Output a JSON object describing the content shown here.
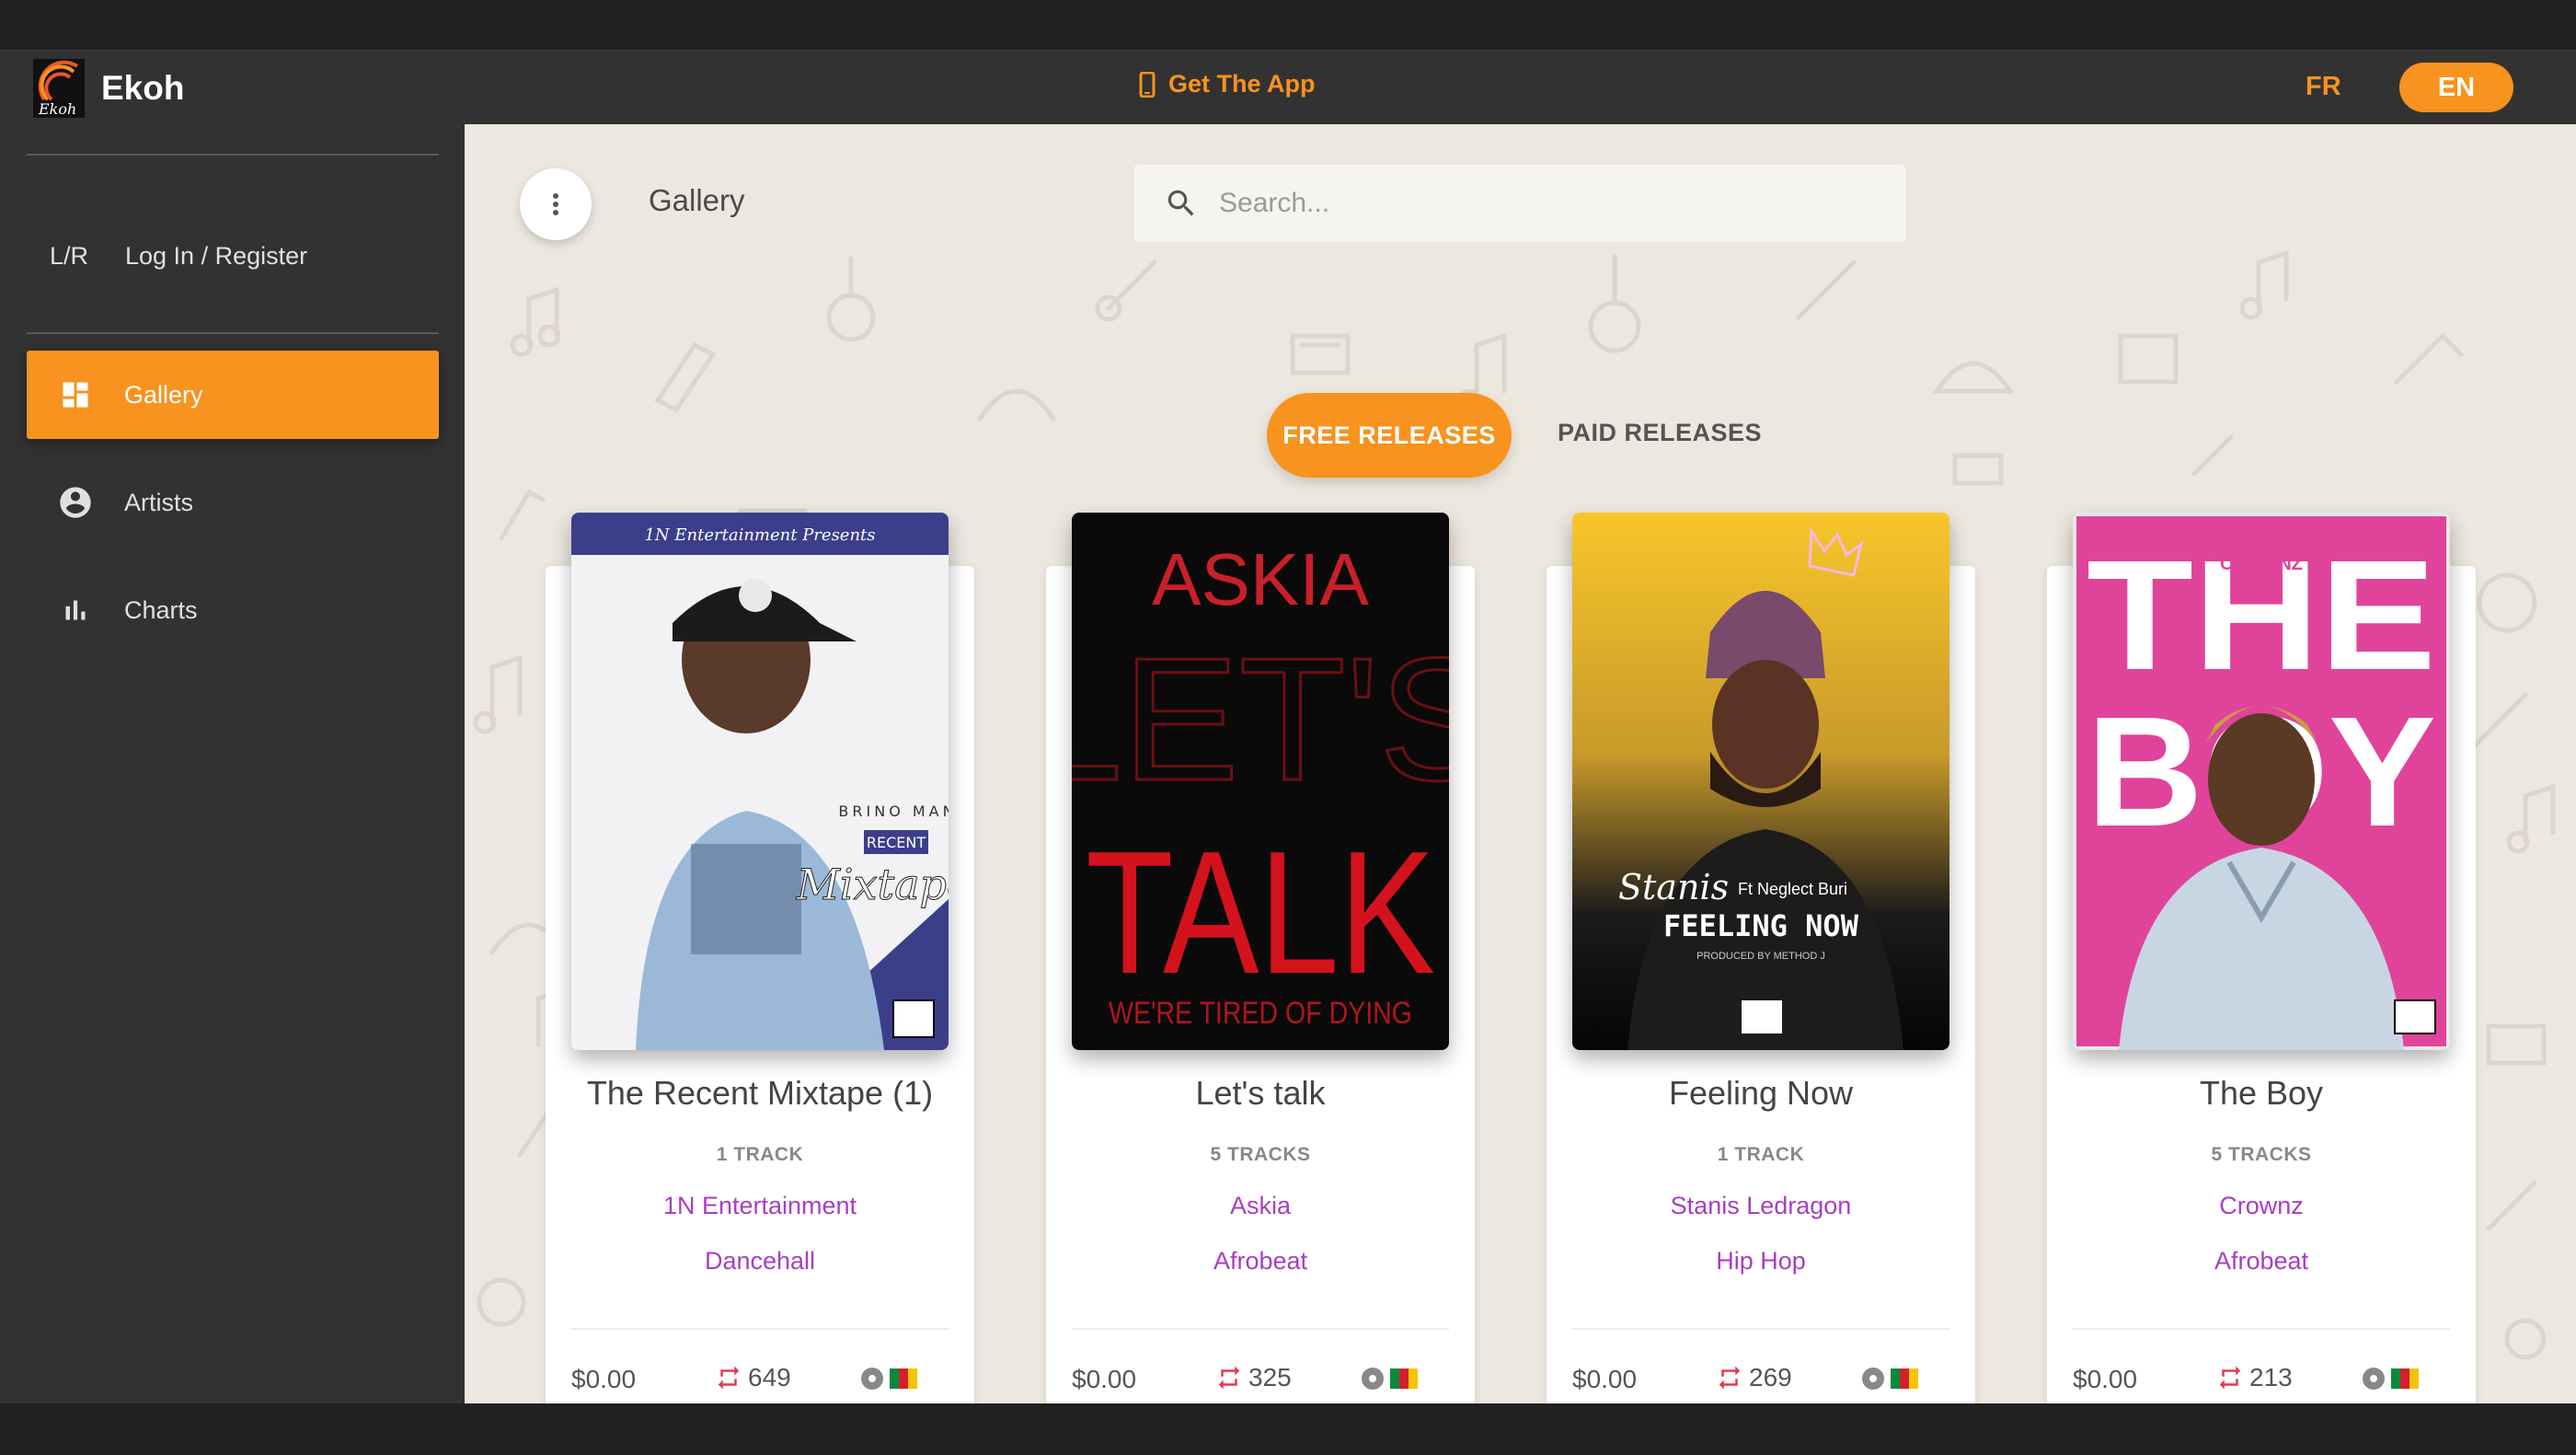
{
  "header": {
    "brand": "Ekoh",
    "get_app": "Get The App",
    "lang_fr": "FR",
    "lang_en": "EN",
    "accent": "#f7931e"
  },
  "sidebar": {
    "login_abbr": "L/R",
    "login_label": "Log In / Register",
    "items": [
      {
        "label": "Gallery",
        "icon": "dashboard-icon",
        "active": true
      },
      {
        "label": "Artists",
        "icon": "account-circle-icon",
        "active": false
      },
      {
        "label": "Charts",
        "icon": "bar-chart-icon",
        "active": false
      }
    ]
  },
  "main": {
    "title": "Gallery",
    "search_placeholder": "Search...",
    "tabs": [
      "FREE RELEASES",
      "PAID RELEASES"
    ],
    "cards": [
      {
        "title": "The Recent Mixtape (1)",
        "tracks": "1 TRACK",
        "artist": "1N Entertainment",
        "genre": "Dancehall",
        "price": "$0.00",
        "plays": "649"
      },
      {
        "title": "Let's talk",
        "tracks": "5 TRACKS",
        "artist": "Askia",
        "genre": "Afrobeat",
        "price": "$0.00",
        "plays": "325"
      },
      {
        "title": "Feeling Now",
        "tracks": "1 TRACK",
        "artist": "Stanis Ledragon",
        "genre": "Hip Hop",
        "price": "$0.00",
        "plays": "269"
      },
      {
        "title": "The Boy",
        "tracks": "5 TRACKS",
        "artist": "Crownz",
        "genre": "Afrobeat",
        "price": "$0.00",
        "plays": "213"
      }
    ],
    "covers": [
      {
        "header": "1N Entertainment Presents",
        "line1": "BRINO MAN",
        "line2": "RECENT",
        "line3": "Mixtape"
      },
      {
        "line1": "ASKIA",
        "line2": "LET'S",
        "line3": "TALK",
        "line4": "WE'RE TIRED OF DYING"
      },
      {
        "line1": "Stanis",
        "line2": "Ft Neglect Buri",
        "line3": "FEELING NOW",
        "line4": "PRODUCED BY METHOD J"
      },
      {
        "line1": "CROWNZ",
        "line2": "THE",
        "line3": "BOY"
      }
    ]
  }
}
